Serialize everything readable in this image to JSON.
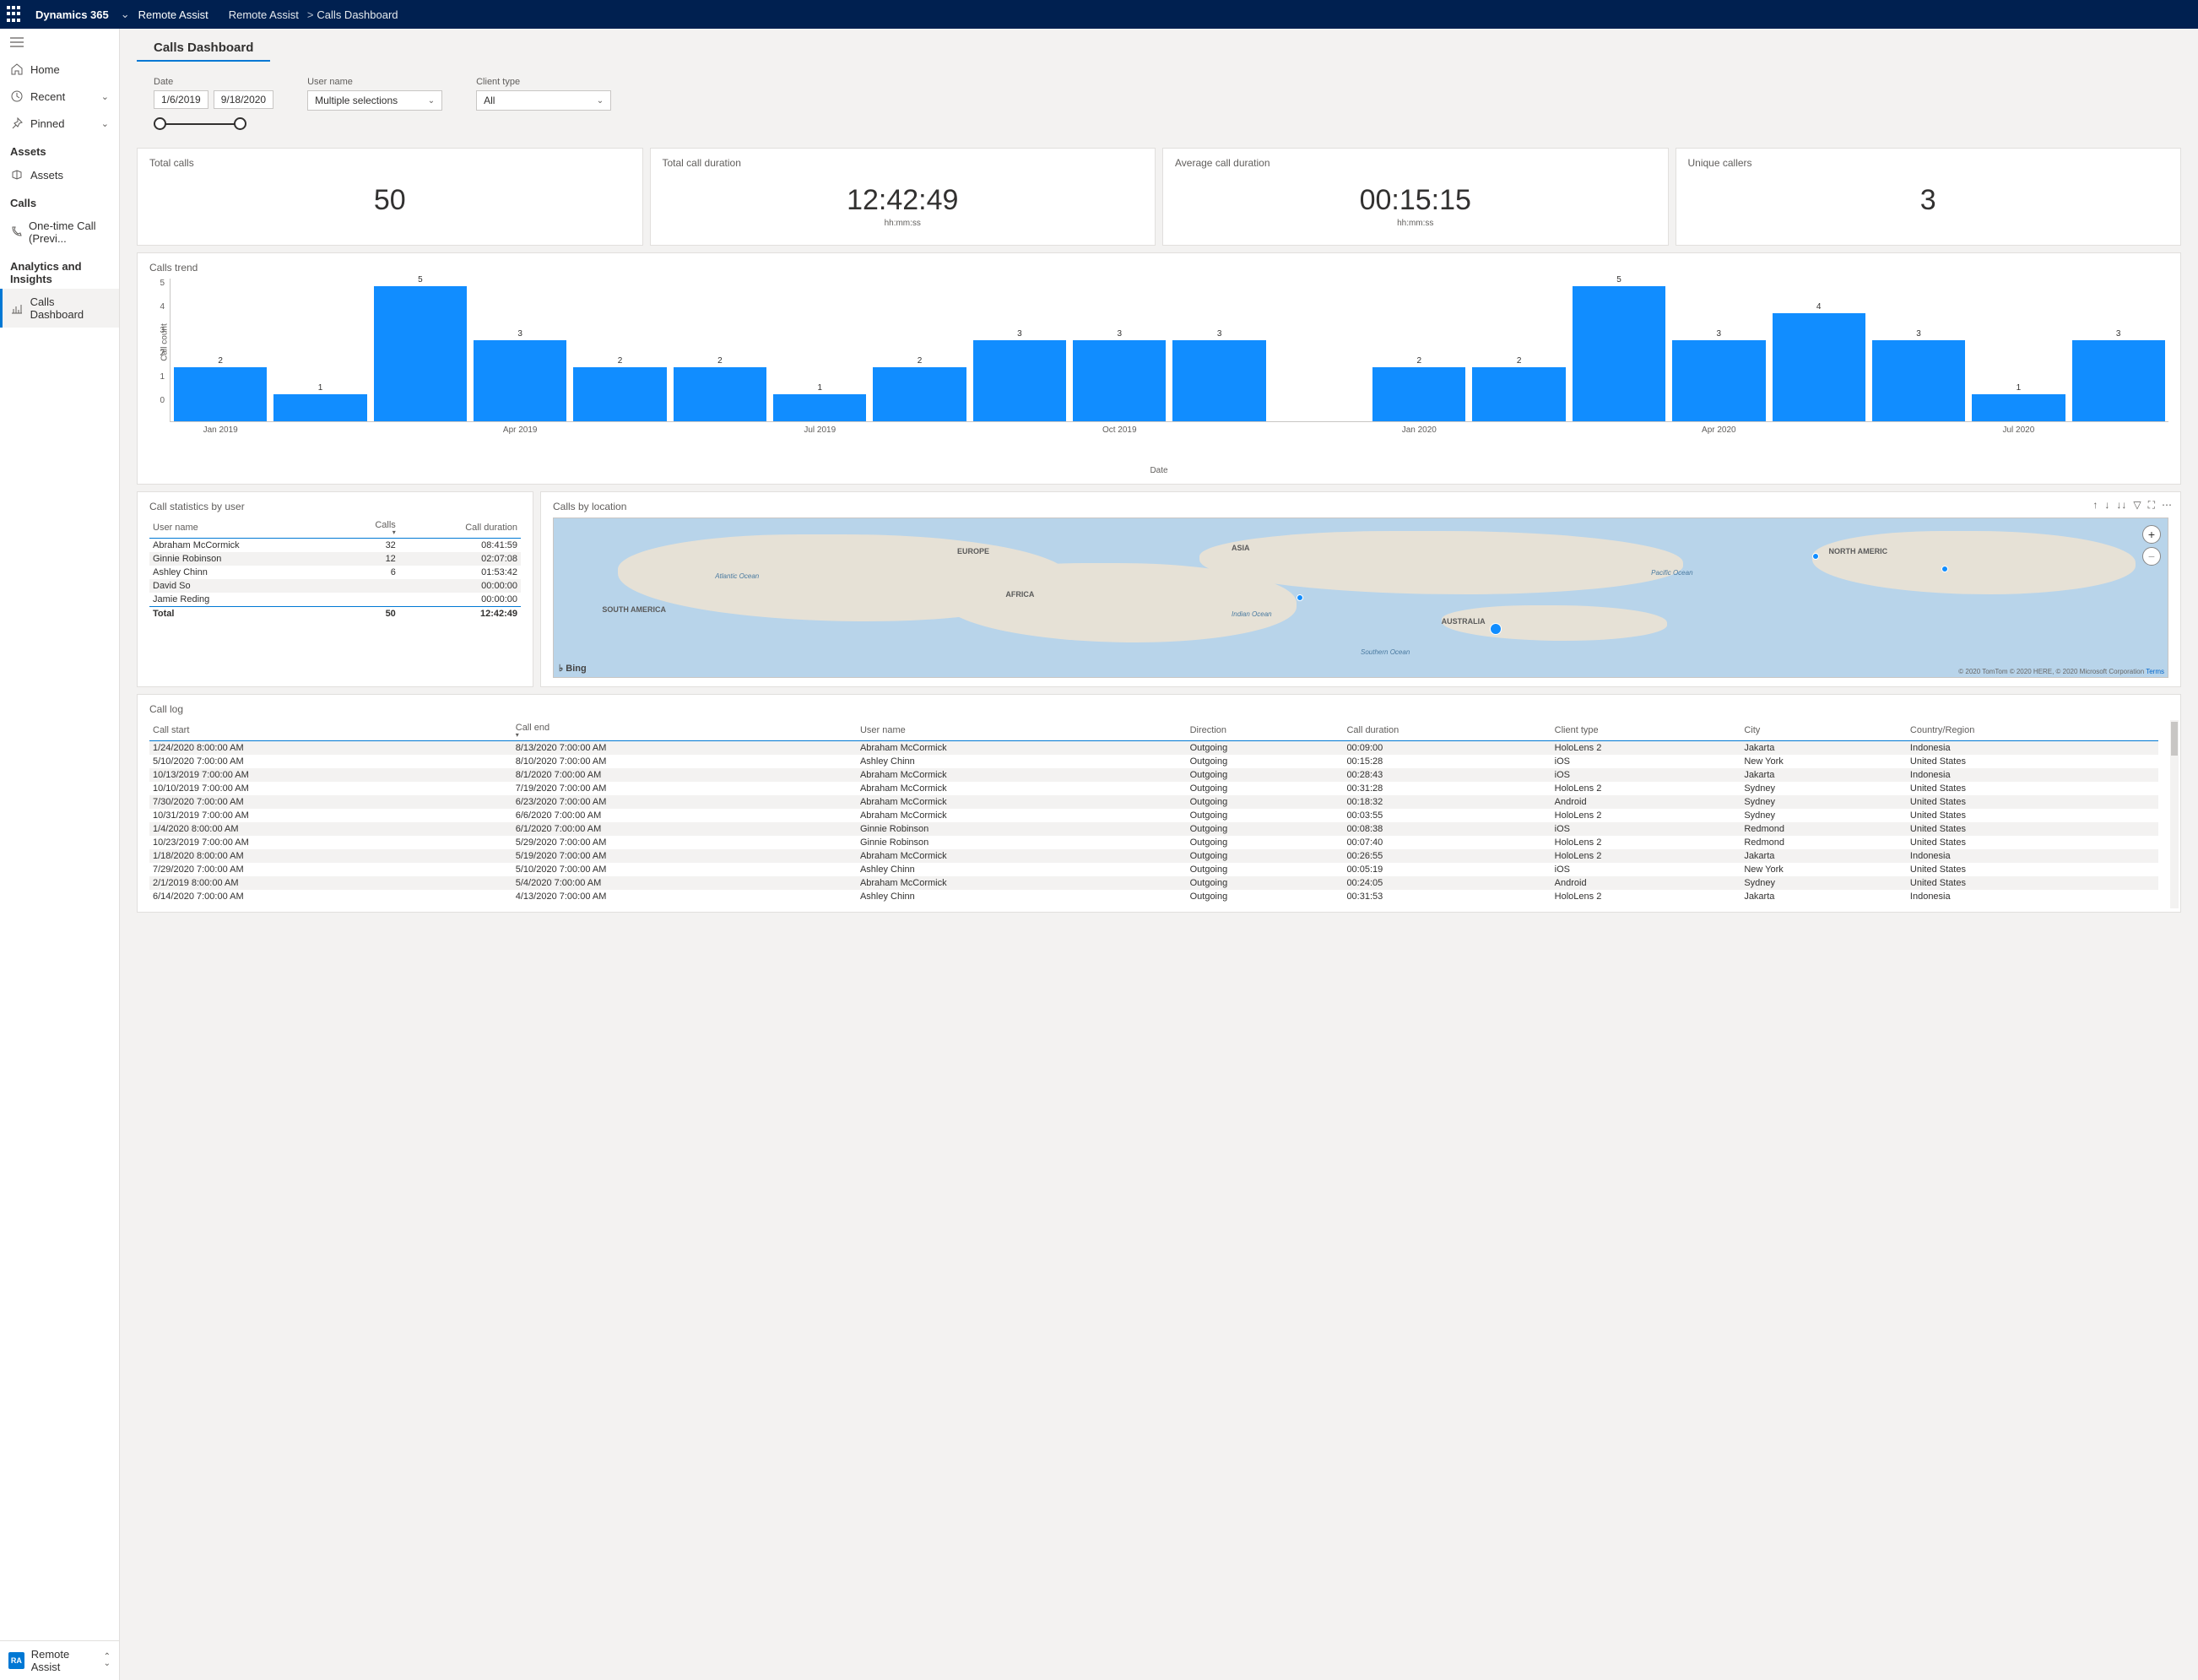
{
  "topbar": {
    "brand": "Dynamics 365",
    "app": "Remote Assist",
    "crumb1": "Remote Assist",
    "crumb2": "Calls Dashboard"
  },
  "sidebar": {
    "home": "Home",
    "recent": "Recent",
    "pinned": "Pinned",
    "group_assets": "Assets",
    "assets": "Assets",
    "group_calls": "Calls",
    "onetime": "One-time Call (Previ...",
    "group_analytics": "Analytics and Insights",
    "calls_dash": "Calls Dashboard",
    "footer_app": "Remote Assist",
    "footer_badge": "RA"
  },
  "page": {
    "title": "Calls Dashboard"
  },
  "filters": {
    "date_label": "Date",
    "date_from": "1/6/2019",
    "date_to": "9/18/2020",
    "user_label": "User name",
    "user_value": "Multiple selections",
    "client_label": "Client type",
    "client_value": "All"
  },
  "cards": {
    "total_calls_label": "Total calls",
    "total_calls_value": "50",
    "total_dur_label": "Total call duration",
    "total_dur_value": "12:42:49",
    "total_dur_sub": "hh:mm:ss",
    "avg_dur_label": "Average call duration",
    "avg_dur_value": "00:15:15",
    "avg_dur_sub": "hh:mm:ss",
    "unique_label": "Unique callers",
    "unique_value": "3"
  },
  "trend": {
    "title": "Calls trend",
    "ylabel": "Call count",
    "xlabel": "Date"
  },
  "chart_data": {
    "type": "bar",
    "title": "Calls trend",
    "xlabel": "Date",
    "ylabel": "Call count",
    "ylim": [
      0,
      5
    ],
    "categories": [
      "Jan 2019",
      "Feb 2019",
      "Mar 2019",
      "Apr 2019",
      "May 2019",
      "Jun 2019",
      "Jul 2019",
      "Aug 2019",
      "Sep 2019",
      "Oct 2019",
      "Nov 2019",
      "Dec 2019",
      "Jan 2020",
      "Feb 2020",
      "Mar 2020",
      "Apr 2020",
      "May 2020",
      "Jun 2020",
      "Jul 2020",
      "Aug 2020"
    ],
    "values": [
      2,
      1,
      5,
      3,
      2,
      2,
      1,
      2,
      3,
      3,
      3,
      null,
      2,
      2,
      5,
      3,
      4,
      3,
      1,
      3
    ],
    "x_tick_labels": [
      "Jan 2019",
      "Apr 2019",
      "Jul 2019",
      "Oct 2019",
      "Jan 2020",
      "Apr 2020",
      "Jul 2020"
    ]
  },
  "stats": {
    "title": "Call statistics by user",
    "col_user": "User name",
    "col_calls": "Calls",
    "col_dur": "Call duration",
    "rows": [
      {
        "user": "Abraham McCormick",
        "calls": "32",
        "dur": "08:41:59"
      },
      {
        "user": "Ginnie Robinson",
        "calls": "12",
        "dur": "02:07:08"
      },
      {
        "user": "Ashley Chinn",
        "calls": "6",
        "dur": "01:53:42"
      },
      {
        "user": "David So",
        "calls": "",
        "dur": "00:00:00"
      },
      {
        "user": "Jamie Reding",
        "calls": "",
        "dur": "00:00:00"
      }
    ],
    "total_label": "Total",
    "total_calls": "50",
    "total_dur": "12:42:49"
  },
  "map": {
    "title": "Calls by location",
    "bing": "Bing",
    "attrib": "© 2020 TomTom © 2020 HERE, © 2020 Microsoft Corporation",
    "terms": "Terms",
    "labels": {
      "europe": "EUROPE",
      "asia": "ASIA",
      "na": "NORTH AMERIC",
      "africa": "AFRICA",
      "sa": "SOUTH AMERICA",
      "aus": "AUSTRALIA",
      "atlantic": "Atlantic Ocean",
      "indian": "Indian Ocean",
      "pacific": "Pacific Ocean",
      "southern": "Southern Ocean"
    }
  },
  "log": {
    "title": "Call log",
    "cols": {
      "start": "Call start",
      "end": "Call end",
      "user": "User name",
      "dir": "Direction",
      "dur": "Call duration",
      "client": "Client type",
      "city": "City",
      "country": "Country/Region"
    },
    "rows": [
      {
        "start": "1/24/2020 8:00:00 AM",
        "end": "8/13/2020 7:00:00 AM",
        "user": "Abraham McCormick",
        "dir": "Outgoing",
        "dur": "00:09:00",
        "client": "HoloLens 2",
        "city": "Jakarta",
        "country": "Indonesia"
      },
      {
        "start": "5/10/2020 7:00:00 AM",
        "end": "8/10/2020 7:00:00 AM",
        "user": "Ashley Chinn",
        "dir": "Outgoing",
        "dur": "00:15:28",
        "client": "iOS",
        "city": "New York",
        "country": "United States"
      },
      {
        "start": "10/13/2019 7:00:00 AM",
        "end": "8/1/2020 7:00:00 AM",
        "user": "Abraham McCormick",
        "dir": "Outgoing",
        "dur": "00:28:43",
        "client": "iOS",
        "city": "Jakarta",
        "country": "Indonesia"
      },
      {
        "start": "10/10/2019 7:00:00 AM",
        "end": "7/19/2020 7:00:00 AM",
        "user": "Abraham McCormick",
        "dir": "Outgoing",
        "dur": "00:31:28",
        "client": "HoloLens 2",
        "city": "Sydney",
        "country": "United States"
      },
      {
        "start": "7/30/2020 7:00:00 AM",
        "end": "6/23/2020 7:00:00 AM",
        "user": "Abraham McCormick",
        "dir": "Outgoing",
        "dur": "00:18:32",
        "client": "Android",
        "city": "Sydney",
        "country": "United States"
      },
      {
        "start": "10/31/2019 7:00:00 AM",
        "end": "6/6/2020 7:00:00 AM",
        "user": "Abraham McCormick",
        "dir": "Outgoing",
        "dur": "00:03:55",
        "client": "HoloLens 2",
        "city": "Sydney",
        "country": "United States"
      },
      {
        "start": "1/4/2020 8:00:00 AM",
        "end": "6/1/2020 7:00:00 AM",
        "user": "Ginnie Robinson",
        "dir": "Outgoing",
        "dur": "00:08:38",
        "client": "iOS",
        "city": "Redmond",
        "country": "United States"
      },
      {
        "start": "10/23/2019 7:00:00 AM",
        "end": "5/29/2020 7:00:00 AM",
        "user": "Ginnie Robinson",
        "dir": "Outgoing",
        "dur": "00:07:40",
        "client": "HoloLens 2",
        "city": "Redmond",
        "country": "United States"
      },
      {
        "start": "1/18/2020 8:00:00 AM",
        "end": "5/19/2020 7:00:00 AM",
        "user": "Abraham McCormick",
        "dir": "Outgoing",
        "dur": "00:26:55",
        "client": "HoloLens 2",
        "city": "Jakarta",
        "country": "Indonesia"
      },
      {
        "start": "7/29/2020 7:00:00 AM",
        "end": "5/10/2020 7:00:00 AM",
        "user": "Ashley Chinn",
        "dir": "Outgoing",
        "dur": "00:05:19",
        "client": "iOS",
        "city": "New York",
        "country": "United States"
      },
      {
        "start": "2/1/2019 8:00:00 AM",
        "end": "5/4/2020 7:00:00 AM",
        "user": "Abraham McCormick",
        "dir": "Outgoing",
        "dur": "00:24:05",
        "client": "Android",
        "city": "Sydney",
        "country": "United States"
      },
      {
        "start": "6/14/2020 7:00:00 AM",
        "end": "4/13/2020 7:00:00 AM",
        "user": "Ashley Chinn",
        "dir": "Outgoing",
        "dur": "00:31:53",
        "client": "HoloLens 2",
        "city": "Jakarta",
        "country": "Indonesia"
      }
    ]
  }
}
